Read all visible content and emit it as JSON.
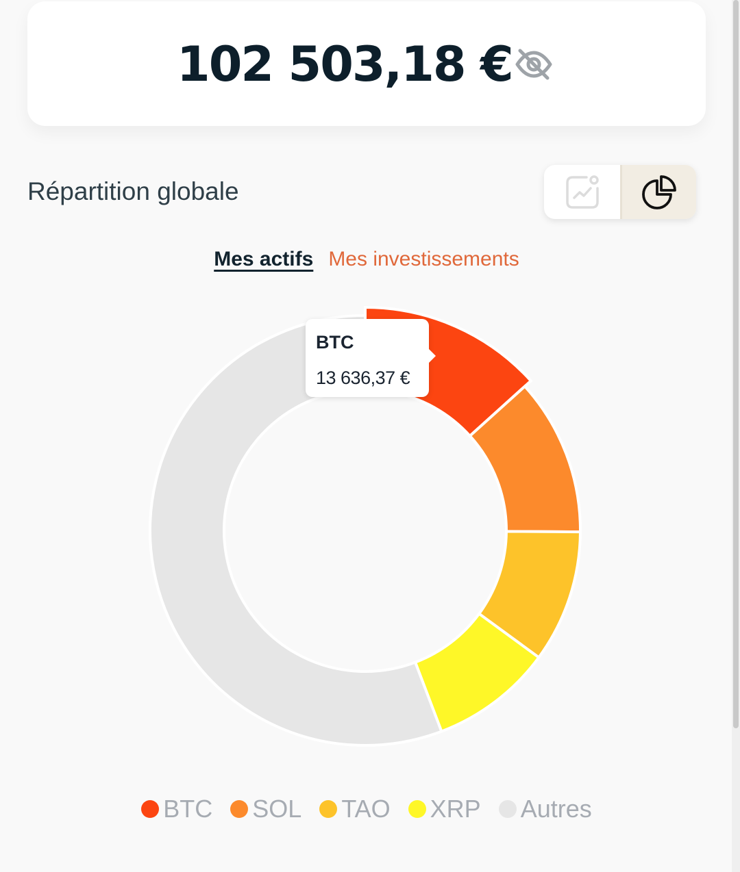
{
  "balance": {
    "amount": "102 503,18 €",
    "visibility_icon": "eye-off-icon"
  },
  "section": {
    "title": "Répartition globale",
    "view_switch": [
      {
        "icon": "line-chart-icon",
        "active": false
      },
      {
        "icon": "pie-chart-icon",
        "active": true
      }
    ]
  },
  "tabs": [
    {
      "label": "Mes actifs",
      "active": true
    },
    {
      "label": "Mes investissements",
      "active": false
    }
  ],
  "tooltip": {
    "label": "BTC",
    "value": "13 636,37 €"
  },
  "chart_data": {
    "type": "pie",
    "labels": [
      "BTC",
      "SOL",
      "TAO",
      "XRP",
      "Autres"
    ],
    "values": [
      13636.37,
      12100,
      10200,
      9400,
      57166.81
    ],
    "colors": [
      "#fc4511",
      "#fc8a2c",
      "#fdc32a",
      "#fef728",
      "#e6e6e6"
    ],
    "legend": "bottom"
  }
}
